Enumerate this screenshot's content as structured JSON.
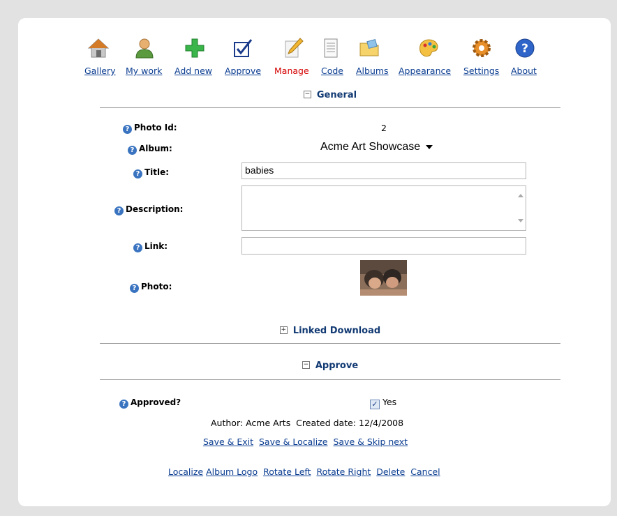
{
  "nav": {
    "items": [
      {
        "label": "Gallery",
        "icon": "house-icon"
      },
      {
        "label": "My work",
        "icon": "person-icon"
      },
      {
        "label": "Add new",
        "icon": "plus-icon"
      },
      {
        "label": "Approve",
        "icon": "checkbox-icon"
      },
      {
        "label": "Manage",
        "icon": "pencil-icon"
      },
      {
        "label": "Code",
        "icon": "document-icon"
      },
      {
        "label": "Albums",
        "icon": "folder-icon"
      },
      {
        "label": "Appearance",
        "icon": "palette-icon"
      },
      {
        "label": "Settings",
        "icon": "gear-icon"
      },
      {
        "label": "About",
        "icon": "help-icon"
      }
    ],
    "active": "Manage"
  },
  "sections": {
    "general": {
      "title": "General",
      "toggle": "⊟"
    },
    "linked_download": {
      "title": "Linked Download",
      "toggle": "⊞"
    },
    "approve": {
      "title": "Approve",
      "toggle": "⊟"
    }
  },
  "form": {
    "photo_id": {
      "label": "Photo Id:",
      "value": "2"
    },
    "album": {
      "label": "Album:",
      "value": "Acme Art Showcase"
    },
    "title": {
      "label": "Title:",
      "value": "babies"
    },
    "description": {
      "label": "Description:",
      "value": ""
    },
    "link": {
      "label": "Link:",
      "value": ""
    },
    "photo": {
      "label": "Photo:"
    },
    "approved": {
      "label": "Approved?",
      "checked": true,
      "checkbox_label": "Yes"
    }
  },
  "meta": {
    "author_label": "Author:",
    "author": "Acme Arts",
    "created_label": "Created date:",
    "created": "12/4/2008"
  },
  "actions": {
    "save_exit": "Save & Exit",
    "save_localize": "Save & Localize",
    "save_skip": "Save & Skip next",
    "localize": "Localize",
    "album_logo": "Album Logo",
    "rotate_left": "Rotate Left",
    "rotate_right": "Rotate Right",
    "delete": "Delete",
    "cancel": "Cancel"
  }
}
